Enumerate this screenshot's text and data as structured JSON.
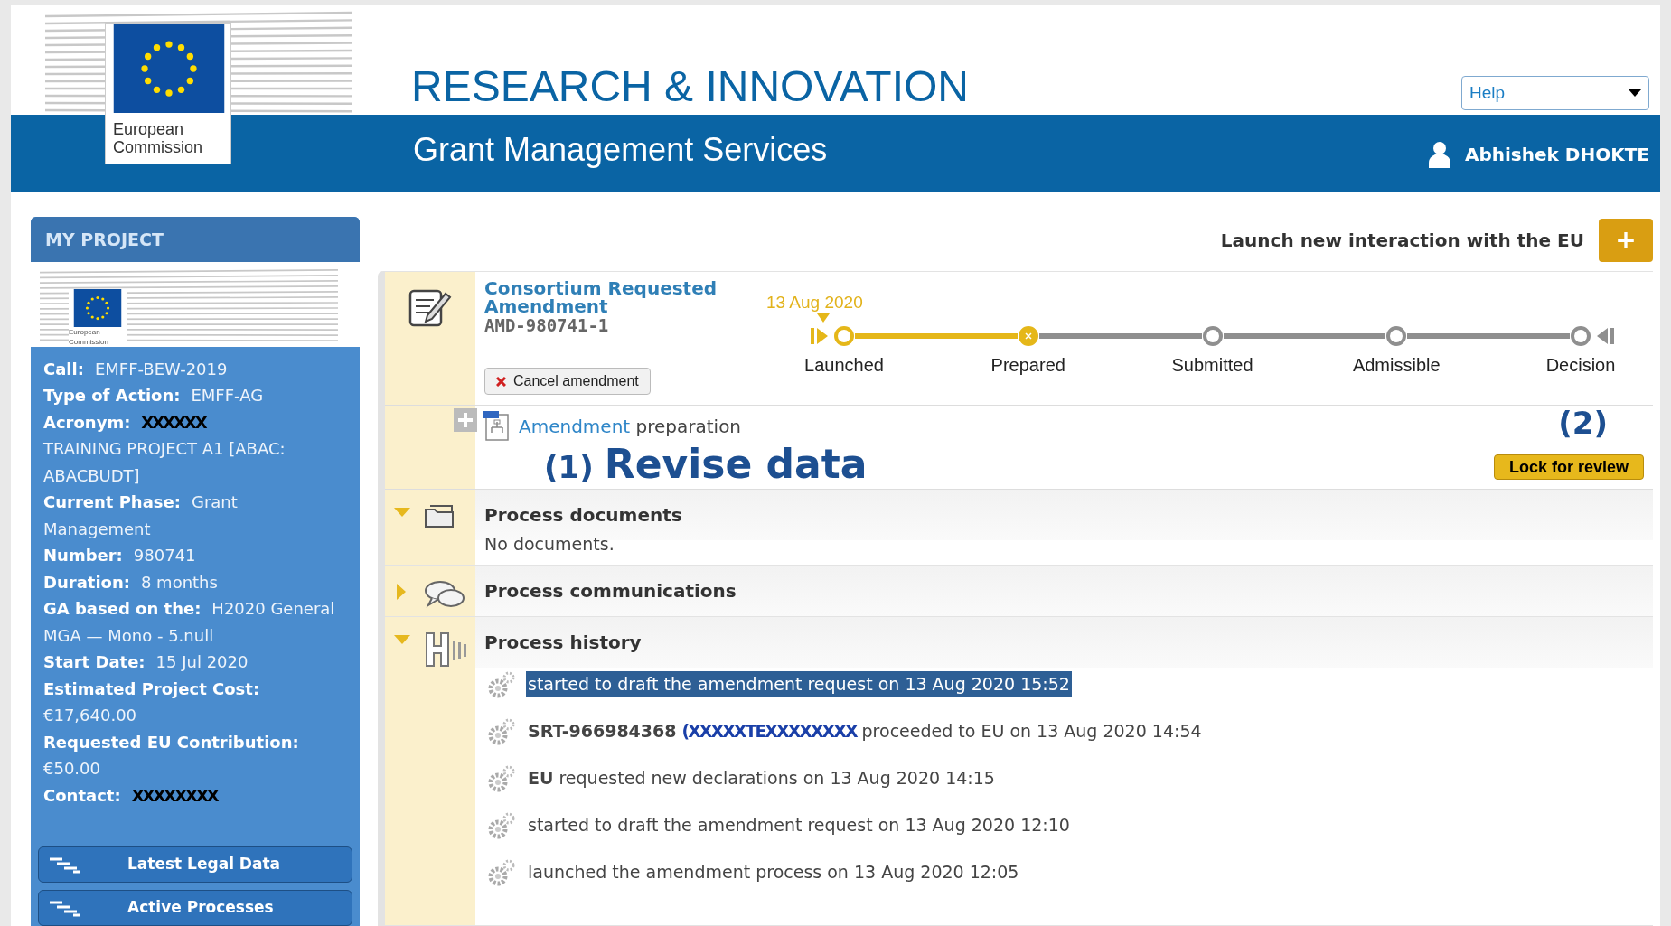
{
  "header": {
    "logo_text": "European Commission",
    "title": "RESEARCH & INNOVATION",
    "subtitle": "Grant Management Services",
    "help": {
      "value": "Help"
    },
    "user": "Abhishek DHOKTE"
  },
  "sidebar": {
    "title": "MY PROJECT",
    "logo_text": "European Commission",
    "fields": [
      {
        "label": "Call:",
        "value": "EMFF-BEW-2019",
        "kind": "text"
      },
      {
        "label": "Type of Action:",
        "value": "EMFF-AG",
        "kind": "text"
      },
      {
        "label": "Acronym:",
        "value": "XXXXXX",
        "kind": "redacted"
      },
      {
        "value": "TRAINING PROJECT A1 [ABAC: ABACBUDT]",
        "kind": "text"
      },
      {
        "label": "Current Phase:",
        "value": "Grant Management",
        "kind": "text"
      },
      {
        "label": "Number:",
        "value": "980741",
        "kind": "text"
      },
      {
        "label": "Duration:",
        "value": "8 months",
        "kind": "text"
      },
      {
        "label": "GA based on the:",
        "value": "H2020 General MGA — Mono - 5.null",
        "kind": "text"
      },
      {
        "label": "Start Date:",
        "value": "15 Jul 2020",
        "kind": "text"
      },
      {
        "label": "Estimated Project Cost:",
        "value": "€17,640.00",
        "kind": "text"
      },
      {
        "label": "Requested EU Contribution:",
        "value": "€50.00",
        "kind": "text"
      },
      {
        "label": "Contact:",
        "value": "XXXXXXXX",
        "kind": "redacted"
      }
    ],
    "buttons": [
      "Latest Legal Data",
      "Active Processes"
    ]
  },
  "launch": {
    "label": "Launch new interaction with the EU",
    "button": "+"
  },
  "process": {
    "title": "Consortium Requested Amendment",
    "code": "AMD-980741-1",
    "cancel": "Cancel amendment",
    "steps": [
      {
        "label": "Launched",
        "date": "13 Aug 2020",
        "reached": true,
        "completed": false
      },
      {
        "label": "Prepared",
        "reached": true,
        "completed": true
      },
      {
        "label": "Submitted",
        "reached": false,
        "completed": false
      },
      {
        "label": "Admissible",
        "reached": false,
        "completed": false
      },
      {
        "label": "Decision",
        "reached": false,
        "completed": false
      }
    ],
    "task_link": "Amendment",
    "task_text": "preparation",
    "note_1_num": "(1)",
    "note_1": "Revise data",
    "note_2": "(2)",
    "lock": "Lock for review"
  },
  "sections": [
    {
      "title": "Process documents",
      "expanded": true,
      "kind": "documents",
      "body": "No documents."
    },
    {
      "title": "Process communications",
      "expanded": false,
      "kind": "communications"
    },
    {
      "title": "Process history",
      "expanded": true,
      "kind": "history"
    }
  ],
  "history": [
    {
      "text": "started to draft the amendment request on 13 Aug 2020 15:52",
      "selected": true
    },
    {
      "text": "**SRT-966984368**",
      "redaction": "(XXXXXTEXXXXXXXX",
      "rest": "proceeded to EU on 13 Aug 2020 14:54",
      "selected": false
    },
    {
      "text": "**EU** requested new declarations on 13 Aug 2020 14:15",
      "selected": false
    },
    {
      "text": "started to draft the amendment request on 13 Aug 2020 12:10",
      "selected": false
    },
    {
      "text": "launched the amendment process on 13 Aug 2020 12:05",
      "selected": false
    }
  ]
}
